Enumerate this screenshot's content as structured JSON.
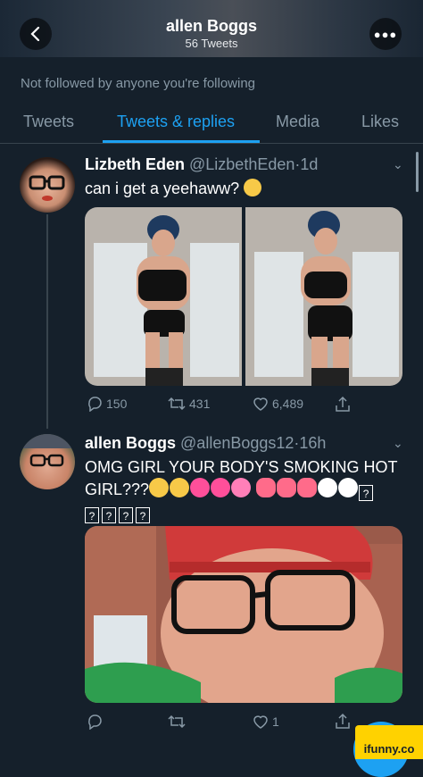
{
  "header": {
    "title": "allen Boggs",
    "subtitle": "56 Tweets"
  },
  "profile": {
    "followed_text": "Not followed by anyone you're following"
  },
  "tabs": [
    {
      "label": "Tweets",
      "active": false
    },
    {
      "label": "Tweets & replies",
      "active": true
    },
    {
      "label": "Media",
      "active": false
    },
    {
      "label": "Likes",
      "active": false
    }
  ],
  "tweets": [
    {
      "name": "Lizbeth Eden",
      "handle": "@LizbethEden",
      "time": "1d",
      "text": "can i get a yeehaww?",
      "emoji": "cowboy-face",
      "actions": {
        "replies": "150",
        "retweets": "431",
        "likes": "6,489"
      }
    },
    {
      "name": "allen Boggs",
      "handle": "@allenBoggs12",
      "time": "16h",
      "text_line1": "OMG GIRL YOUR BODY'S SMOKING HOT",
      "text_line2": "GIRL???",
      "emoji": [
        "hugging-face",
        "hugging-face",
        "sparkling-heart",
        "sparkling-heart",
        "two-hearts",
        "lips",
        "lips",
        "lips",
        "eyes",
        "eyes"
      ],
      "unsupported_glyph": "?",
      "actions": {
        "replies": "",
        "retweets": "",
        "likes": "1"
      }
    }
  ],
  "watermark": {
    "label": "ifunny.co"
  },
  "colors": {
    "background": "#15202b",
    "accent": "#1da1f2",
    "muted": "#8899a6",
    "border": "#38444d"
  }
}
